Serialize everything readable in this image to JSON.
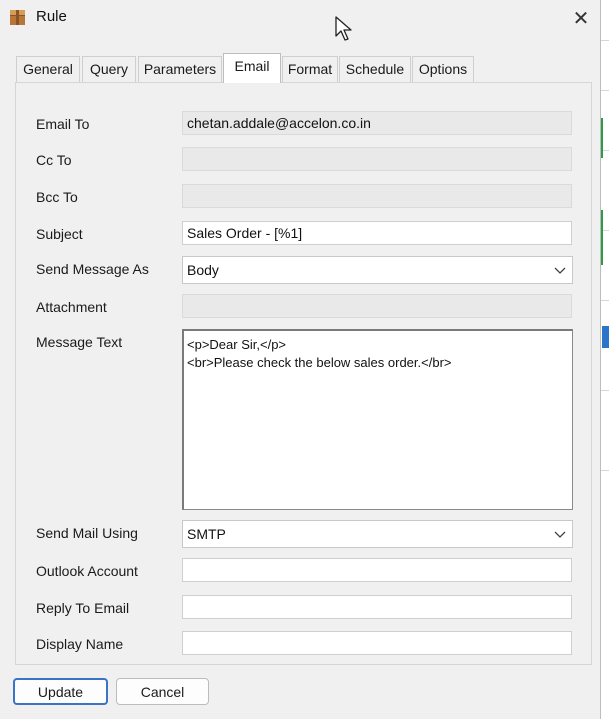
{
  "window": {
    "title": "Rule",
    "close_glyph": "✕",
    "app_icon": "package-icon"
  },
  "tabs": [
    {
      "label": "General",
      "active": false
    },
    {
      "label": "Query",
      "active": false
    },
    {
      "label": "Parameters",
      "active": false
    },
    {
      "label": "Email",
      "active": true
    },
    {
      "label": "Format",
      "active": false
    },
    {
      "label": "Schedule",
      "active": false
    },
    {
      "label": "Options",
      "active": false
    }
  ],
  "form": {
    "email_to": {
      "label": "Email To",
      "value": "chetan.addale@accelon.co.in"
    },
    "cc_to": {
      "label": "Cc To",
      "value": ""
    },
    "bcc_to": {
      "label": "Bcc To",
      "value": ""
    },
    "subject": {
      "label": "Subject",
      "value": "Sales Order - [%1]"
    },
    "send_message_as": {
      "label": "Send Message As",
      "value": "Body"
    },
    "attachment": {
      "label": "Attachment",
      "value": ""
    },
    "message_text": {
      "label": "Message Text",
      "value": "<p>Dear Sir,</p>\n<br>Please check the below sales order.</br>"
    },
    "send_mail_using": {
      "label": "Send Mail Using",
      "value": "SMTP"
    },
    "outlook_account": {
      "label": "Outlook Account",
      "value": ""
    },
    "reply_to_email": {
      "label": "Reply To Email",
      "value": ""
    },
    "display_name": {
      "label": "Display Name",
      "value": ""
    }
  },
  "buttons": {
    "update": "Update",
    "cancel": "Cancel"
  },
  "colors": {
    "accent": "#3b73c7",
    "disabled_field": "#e9e9e9",
    "background": "#f0f0f0"
  }
}
